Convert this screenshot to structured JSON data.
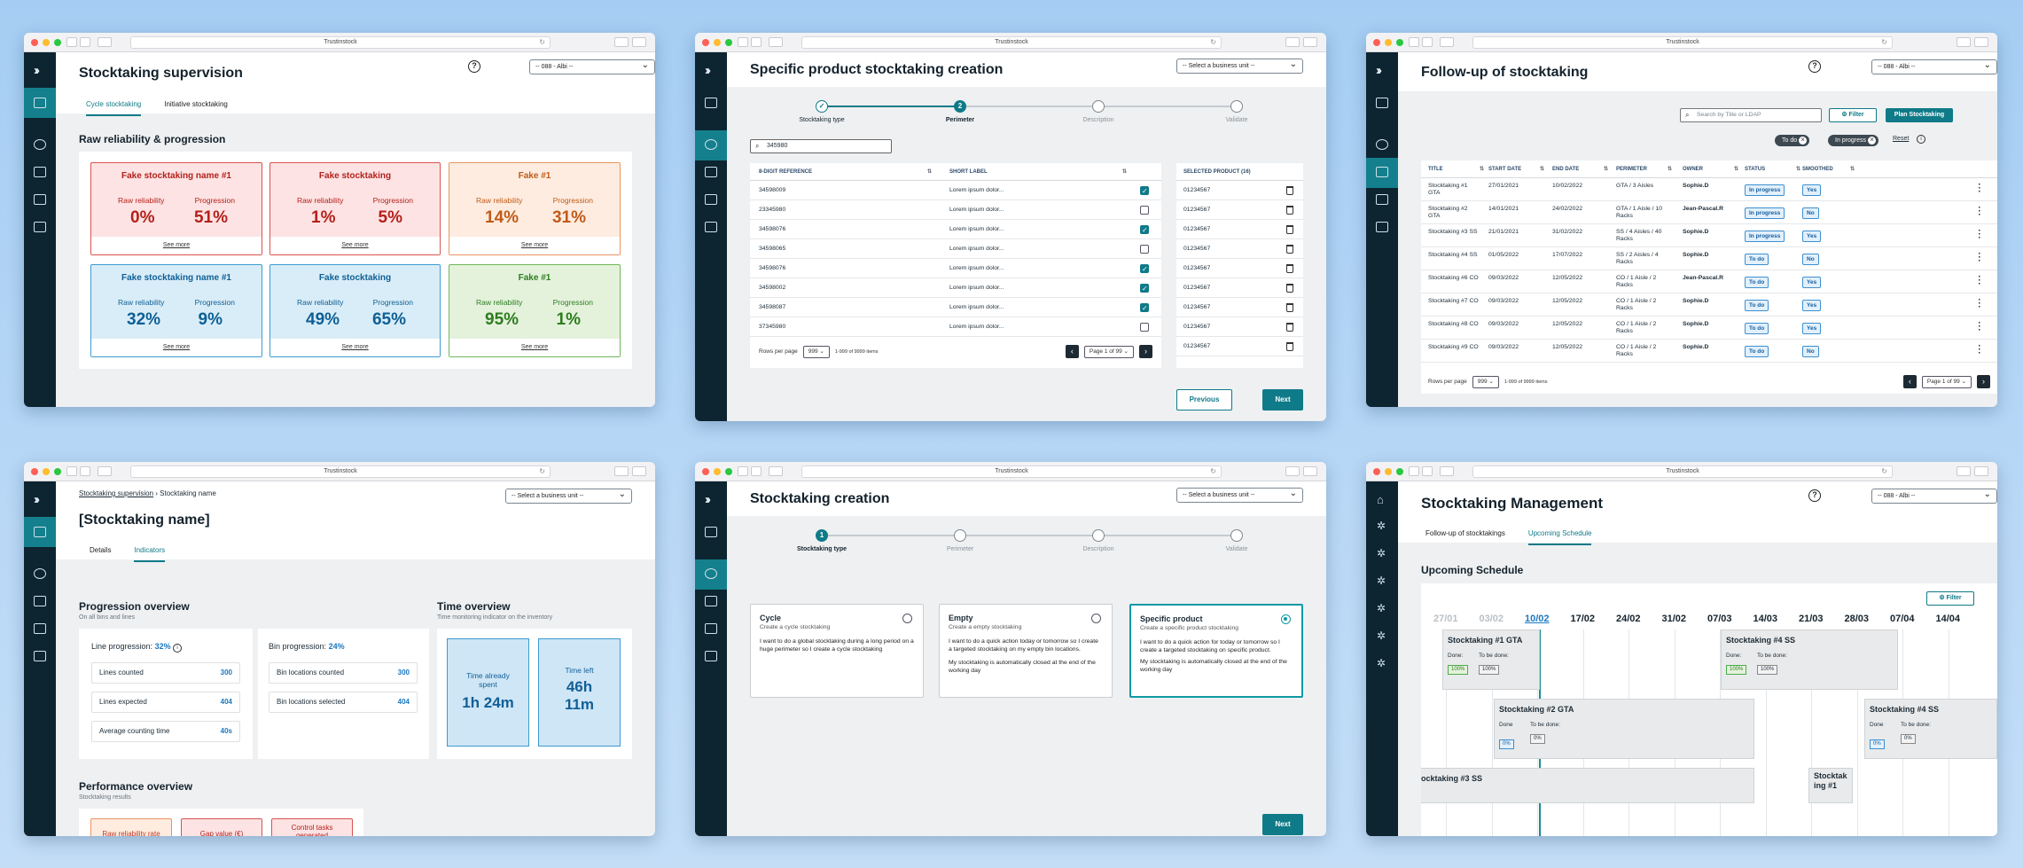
{
  "browser": {
    "url": "Trustinstock"
  },
  "w1": {
    "title": "Stocktaking supervision",
    "bu": "-- 088 - Albi --",
    "help": "?",
    "tabs": [
      "Cycle stocktaking",
      "Initiative stocktaking"
    ],
    "section": "Raw reliability & progression",
    "raw_label": "Raw reliability",
    "prog_label": "Progression",
    "see_more": "See more",
    "cards": [
      {
        "name": "Fake stocktaking name #1",
        "raw": "0%",
        "prog": "51%",
        "tone": "red"
      },
      {
        "name": "Fake stocktaking",
        "raw": "1%",
        "prog": "5%",
        "tone": "red"
      },
      {
        "name": "Fake #1",
        "raw": "14%",
        "prog": "31%",
        "tone": "orange"
      },
      {
        "name": "Fake stocktaking name #1",
        "raw": "32%",
        "prog": "9%",
        "tone": "blue"
      },
      {
        "name": "Fake stocktaking",
        "raw": "49%",
        "prog": "65%",
        "tone": "blue"
      },
      {
        "name": "Fake #1",
        "raw": "95%",
        "prog": "1%",
        "tone": "green"
      }
    ]
  },
  "w2": {
    "title": "Specific product stocktaking creation",
    "bu": "-- Select a business unit --",
    "steps": [
      "Stocktaking type",
      "Perimeter",
      "Description",
      "Validate"
    ],
    "step2_num": "2",
    "search": "345980",
    "headers": [
      "8-DIGIT REFERENCE",
      "SHORT LABEL"
    ],
    "rows": [
      {
        "ref": "34598009",
        "label": "Lorem ipsum dolor...",
        "checked": true
      },
      {
        "ref": "23345980",
        "label": "Lorem ipsum dolor...",
        "checked": false
      },
      {
        "ref": "34598076",
        "label": "Lorem ipsum dolor...",
        "checked": true
      },
      {
        "ref": "34598065",
        "label": "Lorem ipsum dolor...",
        "checked": false
      },
      {
        "ref": "34598076",
        "label": "Lorem ipsum dolor...",
        "checked": true
      },
      {
        "ref": "34598002",
        "label": "Lorem ipsum dolor...",
        "checked": true
      },
      {
        "ref": "34598087",
        "label": "Lorem ipsum dolor...",
        "checked": true
      },
      {
        "ref": "37345980",
        "label": "Lorem ipsum dolor...",
        "checked": false
      }
    ],
    "rows_per_page": "Rows per page",
    "rpp_value": "999",
    "range": "1-999 of 9999 items",
    "page": "Page 1 of 99",
    "selected_header": "SELECTED PRODUCT (16)",
    "selected": [
      "01234567",
      "01234567",
      "01234567",
      "01234567",
      "01234567",
      "01234567",
      "01234567",
      "01234567",
      "01234567"
    ],
    "prev": "Previous",
    "next": "Next"
  },
  "w3": {
    "title": "Follow-up of stocktaking",
    "bu": "-- 088 - Albi --",
    "search_ph": "Search by Title or LDAP",
    "filter": "Filter",
    "plan": "Plan Stocktaking",
    "chips": [
      "To do",
      "In progress"
    ],
    "reset": "Reset",
    "headers": [
      "TITLE",
      "START DATE",
      "END DATE",
      "PERIMETER",
      "OWNER",
      "STATUS",
      "SMOOTHED"
    ],
    "rows": [
      {
        "title": "Stocktaking #1 GTA",
        "start": "27/01/2021",
        "end": "10/02/2022",
        "perim": "GTA / 3 Aisles",
        "owner": "Sophie.D",
        "status": "In progress",
        "smooth": "Yes"
      },
      {
        "title": "Stocktaking #2 GTA",
        "start": "14/01/2021",
        "end": "24/02/2022",
        "perim": "GTA / 1 Aisle / 10 Racks",
        "owner": "Jean-Pascal.R",
        "status": "In progress",
        "smooth": "No"
      },
      {
        "title": "Stocktaking #3 SS",
        "start": "21/01/2021",
        "end": "31/02/2022",
        "perim": "SS / 4 Aisles / 40 Racks",
        "owner": "Sophie.D",
        "status": "In progress",
        "smooth": "Yes"
      },
      {
        "title": "Stocktaking #4 SS",
        "start": "01/05/2022",
        "end": "17/07/2022",
        "perim": "SS / 2 Aisles / 4 Racks",
        "owner": "Sophie.D",
        "status": "To do",
        "smooth": "No"
      },
      {
        "title": "Stocktaking #6 CO",
        "start": "09/03/2022",
        "end": "12/05/2022",
        "perim": "CO / 1 Aisle / 2 Racks",
        "owner": "Jean-Pascal.R",
        "status": "To do",
        "smooth": "Yes"
      },
      {
        "title": "Stocktaking #7 CO",
        "start": "09/03/2022",
        "end": "12/05/2022",
        "perim": "CO / 1 Aisle / 2 Racks",
        "owner": "Sophie.D",
        "status": "To do",
        "smooth": "Yes"
      },
      {
        "title": "Stocktaking #8 CO",
        "start": "09/03/2022",
        "end": "12/05/2022",
        "perim": "CO / 1 Aisle / 2 Racks",
        "owner": "Sophie.D",
        "status": "To do",
        "smooth": "Yes"
      },
      {
        "title": "Stocktaking #9 CO",
        "start": "09/03/2022",
        "end": "12/05/2022",
        "perim": "CO / 1 Aisle / 2 Racks",
        "owner": "Sophie.D",
        "status": "To do",
        "smooth": "No"
      }
    ],
    "rows_per_page": "Rows per page",
    "rpp_value": "999",
    "range": "1-999 of 9999 items",
    "page": "Page 1 of 99"
  },
  "w4": {
    "crumb_parent": "Stocktaking supervision",
    "crumb_current": "Stocktaking name",
    "title": "[Stocktaking name]",
    "bu": "-- Select a business unit --",
    "tabs": [
      "Details",
      "Indicators"
    ],
    "prog_title": "Progression overview",
    "prog_sub": "On all bins and lines",
    "line_prog_label": "Line progression:",
    "line_prog_val": "32%",
    "bin_prog_label": "Bin progression:",
    "bin_prog_val": "24%",
    "line_rows": [
      {
        "k": "Lines counted",
        "v": "300"
      },
      {
        "k": "Lines expected",
        "v": "404"
      },
      {
        "k": "Average counting time",
        "v": "40s"
      }
    ],
    "bin_rows": [
      {
        "k": "Bin locations counted",
        "v": "300"
      },
      {
        "k": "Bin locations selected",
        "v": "404"
      }
    ],
    "time_title": "Time overview",
    "time_sub": "Time monitoring indicator on the inventory",
    "spent_label": "Time already spent",
    "spent_val": "1h 24m",
    "left_label": "Time left",
    "left_val": "46h 11m",
    "perf_title": "Performance overview",
    "perf_sub": "Stocktaking results",
    "perf_cards": [
      "Raw reliability rate",
      "Gap value (€)",
      "Control tasks generated"
    ]
  },
  "w5": {
    "title": "Stocktaking creation",
    "bu": "-- Select a business unit --",
    "steps": [
      "Stocktaking type",
      "Perimeter",
      "Description",
      "Validate"
    ],
    "step1_num": "1",
    "options": [
      {
        "title": "Cycle",
        "sub": "Create a cycle stocktaking",
        "desc": "I want to do a global stocktaking during a long period on a huge perimeter so I create a cycle stocktaking",
        "desc2": "",
        "selected": false
      },
      {
        "title": "Empty",
        "sub": "Create a empty stocktaking",
        "desc": "I want to do a quick action today or tomorrow so I create a targeted stocktaking on my empty bin locations.",
        "desc2": "My stocktaking is automatically closed at the end of the working day",
        "selected": false
      },
      {
        "title": "Specific product",
        "sub": "Create a specific product stocktaking",
        "desc": "I want to do a quick action for today or tomorrow so I create a targeted stocktaking on specific product.",
        "desc2": "My stocktaking is automatically closed at the end of the working day",
        "selected": true
      }
    ],
    "next": "Next"
  },
  "w6": {
    "title": "Stocktaking Management",
    "bu": "-- 088 - Albi --",
    "tabs": [
      "Follow-up of stocktakings",
      "Upcoming Schedule"
    ],
    "section": "Upcoming Schedule",
    "filter": "Filter",
    "dates": [
      "27/01",
      "03/02",
      "10/02",
      "17/02",
      "24/02",
      "31/02",
      "07/03",
      "14/03",
      "21/03",
      "28/03",
      "07/04",
      "14/04"
    ],
    "done_label": "Done:",
    "done_label2": "Done",
    "todo_label": "To be done:",
    "bars": [
      {
        "name": "Stocktaking #1 GTA",
        "done": "100%",
        "todo": "100%"
      },
      {
        "name": "Stocktaking #4 SS",
        "done": "100%",
        "todo": "100%"
      },
      {
        "name": "Stocktaking #2 GTA",
        "done": "0%",
        "todo": "0%"
      },
      {
        "name": "Stocktaking #4 SS",
        "done": "0%",
        "todo": "0%"
      },
      {
        "name": "ocktaking #3 SS"
      },
      {
        "name": "Stocktak ing #1"
      }
    ]
  }
}
